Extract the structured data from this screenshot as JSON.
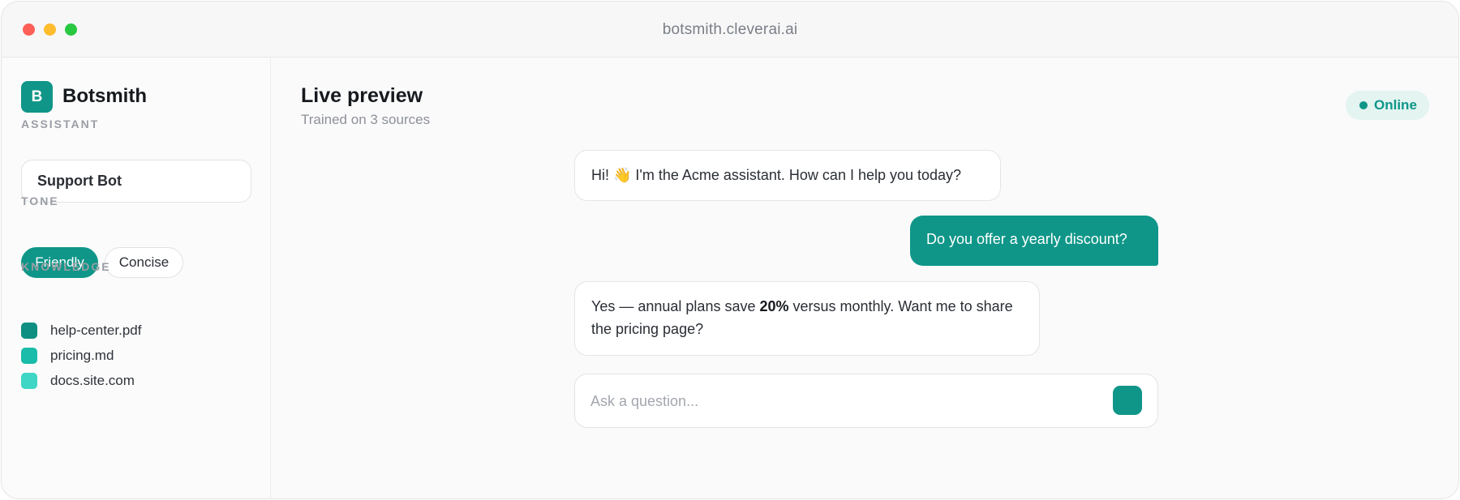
{
  "window": {
    "url": "botsmith.cleverai.ai"
  },
  "sidebar": {
    "logo_letter": "B",
    "brand": "Botsmith",
    "assistant": {
      "label": "ASSISTANT",
      "value": "Support Bot"
    },
    "tone": {
      "label": "TONE",
      "options": [
        {
          "label": "Friendly",
          "selected": true
        },
        {
          "label": "Concise",
          "selected": false
        }
      ]
    },
    "knowledge": {
      "label": "KNOWLEDGE",
      "items": [
        {
          "label": "help-center.pdf",
          "color": "#0f8f81"
        },
        {
          "label": "pricing.md",
          "color": "#1bbcaa"
        },
        {
          "label": "docs.site.com",
          "color": "#3fd6c5"
        }
      ]
    }
  },
  "main": {
    "title": "Live preview",
    "subtitle": "Trained on 3 sources",
    "status": "Online",
    "messages": [
      {
        "role": "bot",
        "text": "Hi! 👋 I'm the Acme assistant. How can I help you today?"
      },
      {
        "role": "user",
        "text": "Do you offer a yearly discount?"
      },
      {
        "role": "bot",
        "text_before": "Yes — annual plans save ",
        "text_bold": "20%",
        "text_after": " versus monthly. Want me to share the pricing page?"
      }
    ],
    "composer": {
      "placeholder": "Ask a question...",
      "value": ""
    }
  },
  "colors": {
    "accent": "#0f9688",
    "status_bg": "#e3f4f1"
  }
}
